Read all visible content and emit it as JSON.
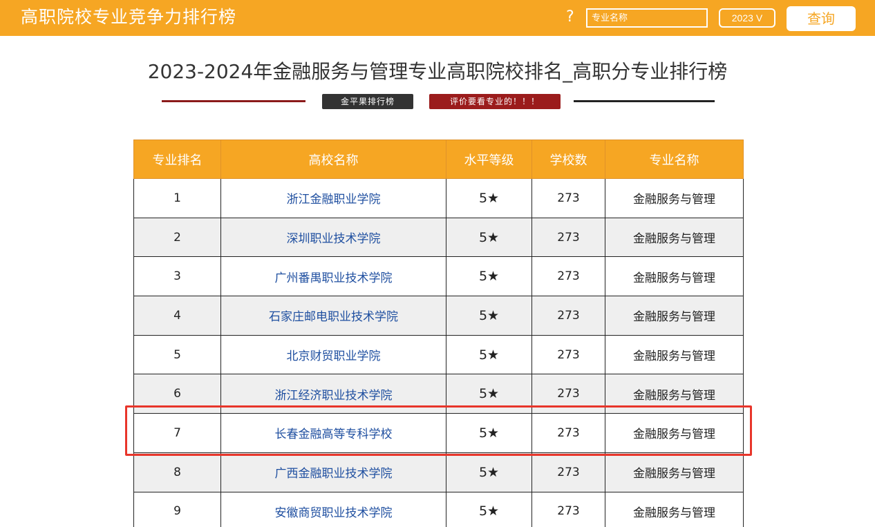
{
  "header": {
    "app_title": "高职院校专业竞争力排行榜",
    "help_icon": "?",
    "search_placeholder": "专业名称",
    "year_value": "2023",
    "year_chevron": "V",
    "query_label": "查询"
  },
  "main": {
    "title": "2023-2024年金融服务与管理专业高职院校排名_高职分专业排行榜",
    "badge_brand": "金平果排行榜",
    "badge_slogan": "评价要看专业的！！！"
  },
  "table": {
    "columns": [
      "专业排名",
      "高校名称",
      "水平等级",
      "学校数",
      "专业名称"
    ],
    "rows": [
      {
        "rank": "1",
        "school": "浙江金融职业学院",
        "level": "5★",
        "count": "273",
        "major": "金融服务与管理"
      },
      {
        "rank": "2",
        "school": "深圳职业技术学院",
        "level": "5★",
        "count": "273",
        "major": "金融服务与管理"
      },
      {
        "rank": "3",
        "school": "广州番禺职业技术学院",
        "level": "5★",
        "count": "273",
        "major": "金融服务与管理"
      },
      {
        "rank": "4",
        "school": "石家庄邮电职业技术学院",
        "level": "5★",
        "count": "273",
        "major": "金融服务与管理"
      },
      {
        "rank": "5",
        "school": "北京财贸职业学院",
        "level": "5★",
        "count": "273",
        "major": "金融服务与管理"
      },
      {
        "rank": "6",
        "school": "浙江经济职业技术学院",
        "level": "5★",
        "count": "273",
        "major": "金融服务与管理"
      },
      {
        "rank": "7",
        "school": "长春金融高等专科学校",
        "level": "5★",
        "count": "273",
        "major": "金融服务与管理"
      },
      {
        "rank": "8",
        "school": "广西金融职业技术学院",
        "level": "5★",
        "count": "273",
        "major": "金融服务与管理"
      },
      {
        "rank": "9",
        "school": "安徽商贸职业技术学院",
        "level": "5★",
        "count": "273",
        "major": "金融服务与管理"
      }
    ]
  },
  "colors": {
    "brand": "#f6a623",
    "highlight": "#e8352a",
    "link": "#1f4fa0"
  }
}
